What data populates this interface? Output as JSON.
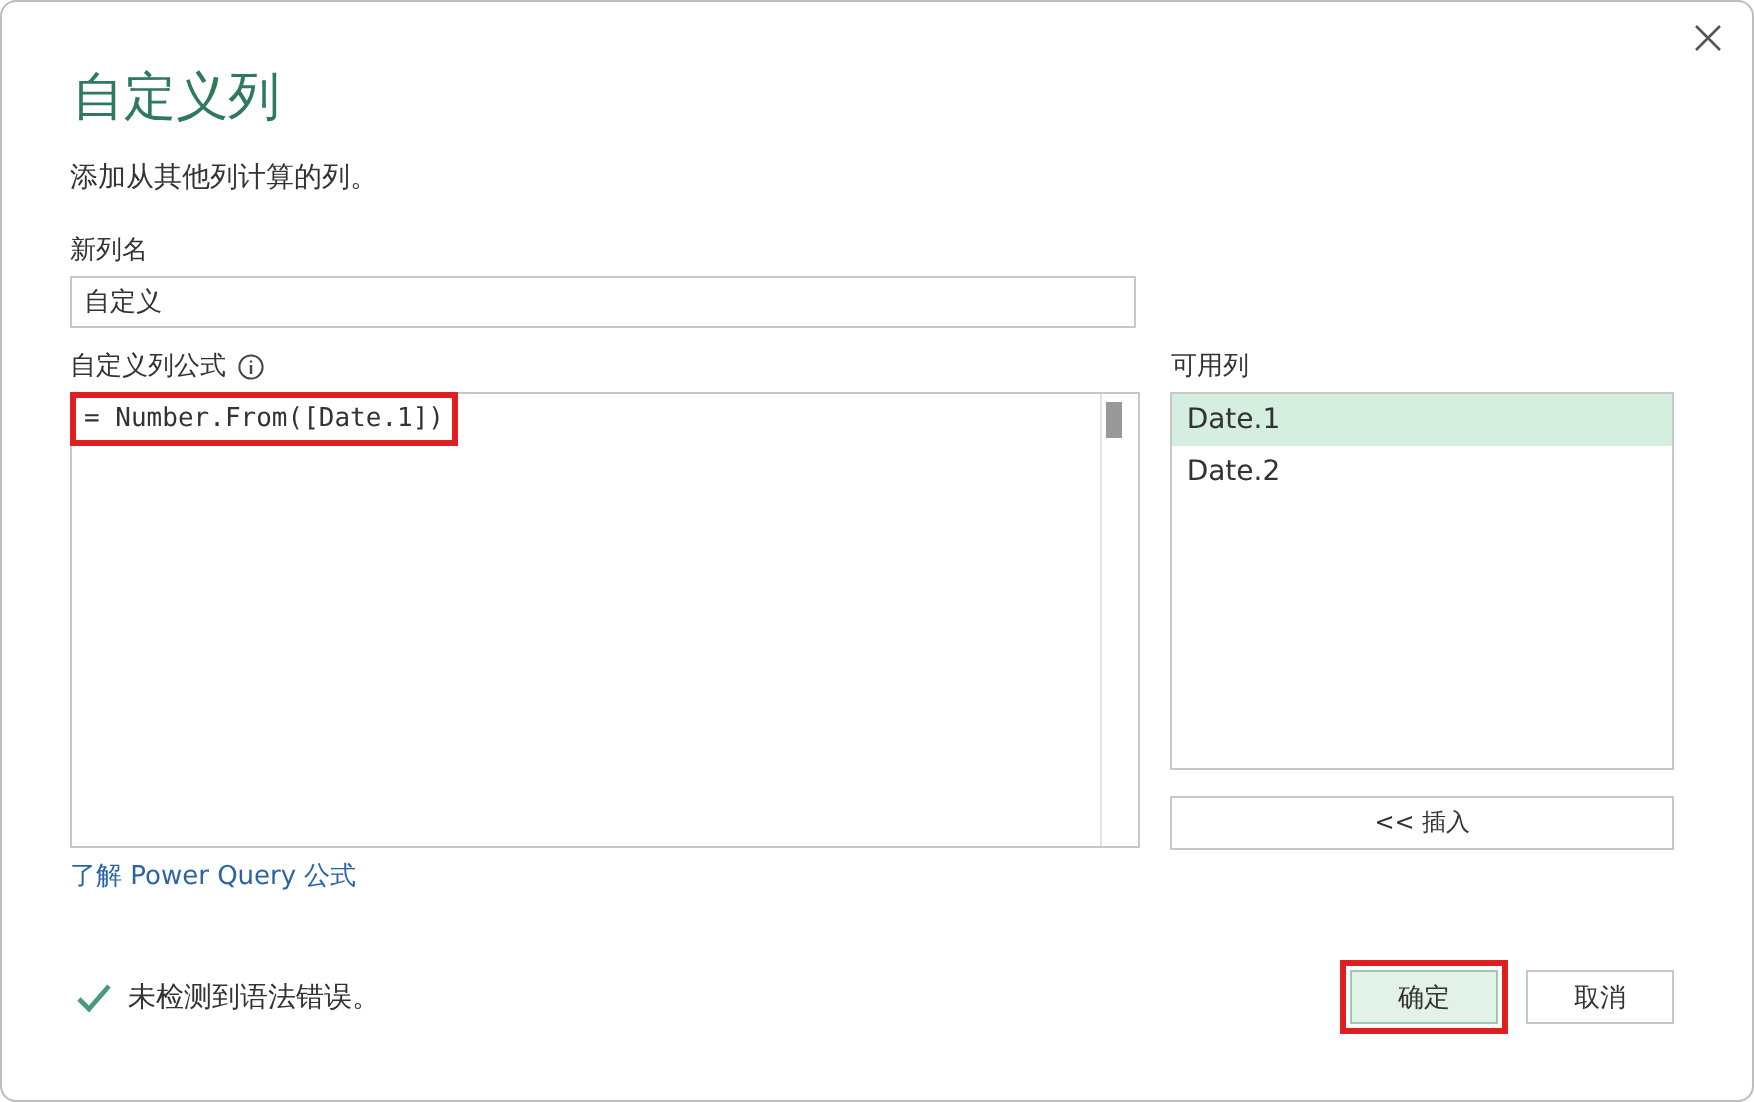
{
  "title": "自定义列",
  "subtitle": "添加从其他列计算的列。",
  "new_column": {
    "label": "新列名",
    "value": "自定义"
  },
  "formula": {
    "label": "自定义列公式",
    "value": "= Number.From([Date.1])",
    "highlighted": true
  },
  "available_columns": {
    "label": "可用列",
    "items": [
      {
        "label": "Date.1",
        "selected": true
      },
      {
        "label": "Date.2",
        "selected": false
      }
    ]
  },
  "insert_button": "<< 插入",
  "learn_link": "了解 Power Query 公式",
  "status": {
    "text": "未检测到语法错误。",
    "ok": true
  },
  "buttons": [
    {
      "label": "确定",
      "kind": "primary",
      "highlighted": true
    },
    {
      "label": "取消",
      "kind": "secondary",
      "highlighted": false
    }
  ]
}
